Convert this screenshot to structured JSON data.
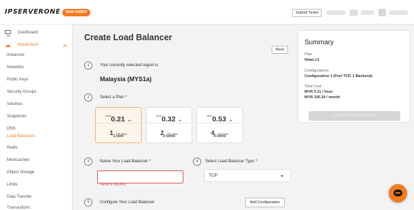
{
  "header": {
    "logo_text": "IPSERVERONE",
    "new_order_label": "NEW ORDER",
    "submit_ticket_label": "Submit Ticket"
  },
  "sidebar": {
    "dashboard": "Dashboard",
    "novacloud": "NovaCloud",
    "items": [
      "Instances",
      "Networks",
      "Public Keys",
      "Security Groups",
      "Volumes",
      "Snapshots",
      "DNS",
      "Load Balancers",
      "Redis",
      "Memcached",
      "Object Storage",
      "Limits",
      "Data Transfer",
      "Transactions"
    ],
    "active_item": "Load Balancers"
  },
  "main": {
    "title": "Create Load Balancer",
    "back_label": "Back",
    "step1": {
      "num": "1",
      "label": "Your currently selected region is",
      "value": "Malaysia (MYS1a)"
    },
    "step2": {
      "num": "2",
      "label": "Select a Plan *"
    },
    "plans": [
      {
        "currency": "MYR",
        "price": "0.21",
        "unit": "/hr",
        "ram": "1",
        "ram_unit": "GB RAM",
        "cores": "1 core",
        "selected": true
      },
      {
        "currency": "MYR",
        "price": "0.32",
        "unit": "/hr",
        "ram": "2",
        "ram_unit": "GB RAM",
        "cores": "2 cores",
        "selected": false
      },
      {
        "currency": "MYR",
        "price": "0.53",
        "unit": "/hr",
        "ram": "4",
        "ram_unit": "GB RAM",
        "cores": "4 cores",
        "selected": false
      }
    ],
    "step3": {
      "num": "3",
      "label": "Name Your Load Balancer *",
      "value": "",
      "error": "Name is required"
    },
    "step4": {
      "num": "4",
      "label": "Select Load Balancer Type *",
      "selected": "TCP"
    },
    "step5": {
      "num": "5",
      "label": "Configure Your Load Balancer",
      "add_label": "Add Configuration"
    }
  },
  "summary": {
    "title": "Summary",
    "plan_label": "Plan",
    "plan_value": "lbaas.c1",
    "config_label": "Configurations",
    "config_value": "Configuration 1 (Port TCP, 1 Backend)",
    "cost_label": "Total Cost",
    "cost_hour": "MYR 0.21 / hour",
    "cost_month": "MYR 156.24 / month",
    "create_label": "Create Load Balancer"
  },
  "colors": {
    "accent": "#f47a20",
    "error": "#d9534f",
    "selected_plan_bg": "#fff4ea"
  }
}
